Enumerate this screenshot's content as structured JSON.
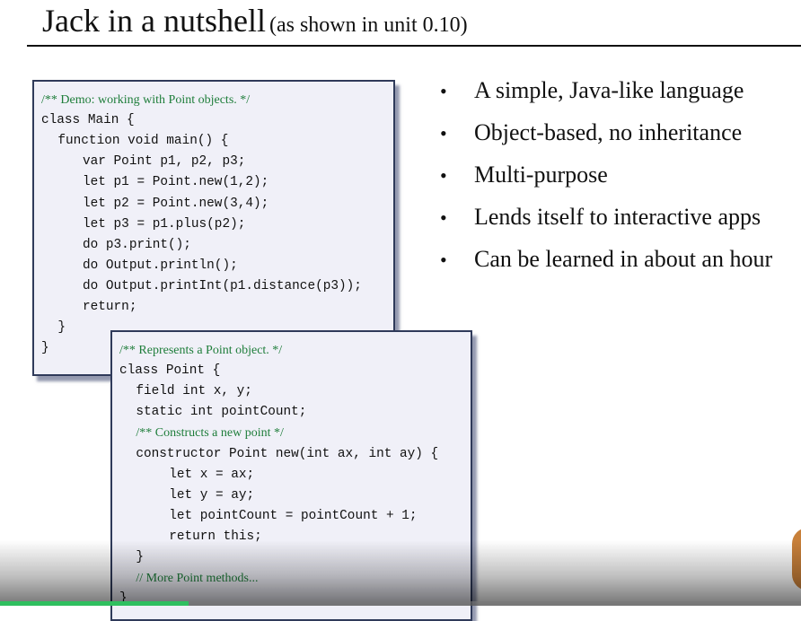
{
  "slide": {
    "title_main": "Jack in a nutshell",
    "title_sub": "(as shown in unit 0.10)"
  },
  "main_code": [
    {
      "text": "/** Demo: working with Point objects. */",
      "kind": "comment",
      "indent": 0
    },
    {
      "text": "class Main {",
      "kind": "code",
      "indent": 0
    },
    {
      "text": "function void main() {",
      "kind": "code",
      "indent": 2
    },
    {
      "text": "var Point p1, p2, p3;",
      "kind": "code",
      "indent": 5
    },
    {
      "text": "let p1 = Point.new(1,2);",
      "kind": "code",
      "indent": 5
    },
    {
      "text": "let p2 = Point.new(3,4);",
      "kind": "code",
      "indent": 5
    },
    {
      "text": "let p3 = p1.plus(p2);",
      "kind": "code",
      "indent": 5
    },
    {
      "text": "do p3.print();",
      "kind": "code",
      "indent": 5
    },
    {
      "text": "do Output.println();",
      "kind": "code",
      "indent": 5
    },
    {
      "text": "do Output.printInt(p1.distance(p3));",
      "kind": "code",
      "indent": 5
    },
    {
      "text": "return;",
      "kind": "code",
      "indent": 5
    },
    {
      "text": "}",
      "kind": "code",
      "indent": 2
    },
    {
      "text": "}",
      "kind": "code",
      "indent": 0
    }
  ],
  "point_code": [
    {
      "text": "/** Represents a Point object. */",
      "kind": "comment",
      "indent": 0
    },
    {
      "text": "class Point {",
      "kind": "code",
      "indent": 0
    },
    {
      "text": "field int x, y;",
      "kind": "code",
      "indent": 2
    },
    {
      "text": "static int pointCount;",
      "kind": "code",
      "indent": 2
    },
    {
      "text": "/** Constructs a new point */",
      "kind": "comment",
      "indent": 2
    },
    {
      "text": "constructor Point new(int ax, int ay) {",
      "kind": "code",
      "indent": 2
    },
    {
      "text": "let x = ax;",
      "kind": "code",
      "indent": 6
    },
    {
      "text": "let y = ay;",
      "kind": "code",
      "indent": 6
    },
    {
      "text": "let pointCount = pointCount + 1;",
      "kind": "code",
      "indent": 6
    },
    {
      "text": "return this;",
      "kind": "code",
      "indent": 6
    },
    {
      "text": "}",
      "kind": "code",
      "indent": 2
    },
    {
      "text": "// More Point methods...",
      "kind": "comment",
      "indent": 2
    },
    {
      "text": "}",
      "kind": "code",
      "indent": 0
    }
  ],
  "bullets": [
    "A simple, Java-like language",
    "Object-based, no inheritance",
    "Multi-purpose",
    "Lends itself to interactive apps",
    "Can be learned in about an hour"
  ],
  "bullet_symbol": "•",
  "video": {
    "progress_fraction": 0.235,
    "progress_color": "#2fbf5f"
  }
}
